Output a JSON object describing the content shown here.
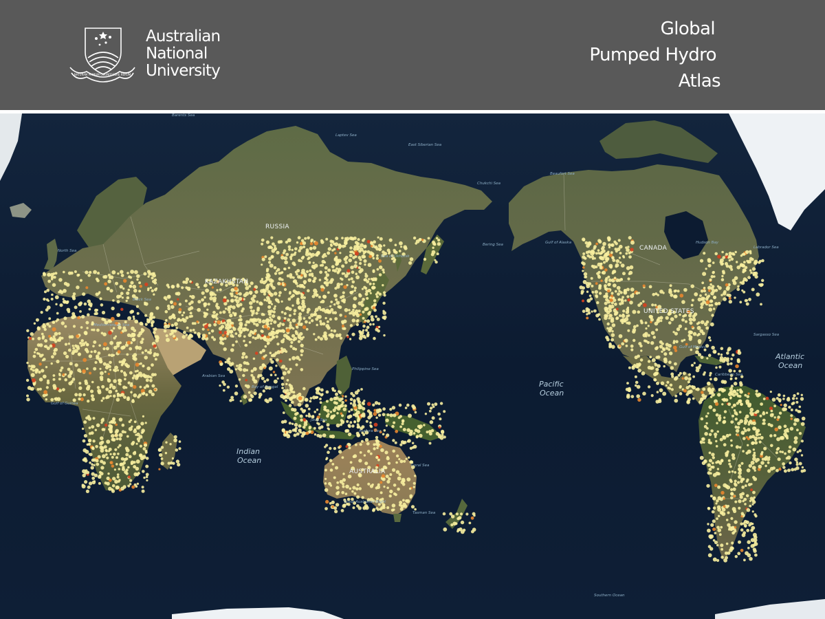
{
  "header": {
    "university_lines": [
      "Australian",
      "National",
      "University"
    ],
    "crest_motto": "NATURAM PRIMUM COGNOSCERE RERUM",
    "atlas_title_lines": [
      "Global",
      "Pumped Hydro",
      "Atlas"
    ],
    "background_color": "#595959"
  },
  "map": {
    "ocean_color": "#0d1d33",
    "land_colors": [
      "#5b6343",
      "#7b7a56",
      "#c9b585"
    ],
    "ice_color": "#eef2f5",
    "site_color": "#f7ee9e",
    "site_highlight_color": "#e9872f",
    "site_red_color": "#d7411f",
    "country_labels": [
      "RUSSIA",
      "KAZAKHSTAN",
      "CANADA",
      "UNITED STATES",
      "AUSTRALIA"
    ],
    "ocean_labels": [
      {
        "line1": "Pacific",
        "line2": "Ocean"
      },
      {
        "line1": "Indian",
        "line2": "Ocean"
      },
      {
        "line1": "Atlantic",
        "line2": "Ocean"
      }
    ],
    "sea_labels": [
      "Barents Sea",
      "Laptev Sea",
      "East Siberian Sea",
      "Chukchi Sea",
      "Beaufort Sea",
      "Sea of Okhotsk",
      "Bering Sea",
      "Gulf of Alaska",
      "Hudson Bay",
      "Labrador Sea",
      "North Sea",
      "Black Sea",
      "Mediterranean Sea",
      "Arabian Sea",
      "Bay of Bengal",
      "Philippine Sea",
      "Java Sea",
      "Arafura Sea",
      "Coral Sea",
      "Tasman Sea",
      "Great Australian Bight",
      "Gulf of Mexico",
      "Caribbean Sea",
      "Sargasso Sea",
      "Gulf of Guinea",
      "Southern Ocean"
    ]
  }
}
